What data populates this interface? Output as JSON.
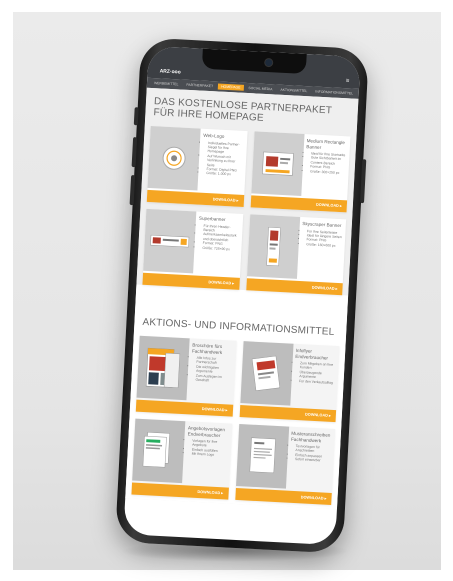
{
  "site": {
    "brand": "ARZ·ooo",
    "tabs": [
      "WERBEMITTEL",
      "PARTNERPAKET",
      "HOMEPAGE",
      "SOCIAL MEDIA",
      "AKTIONSMITTEL",
      "INFORMATIONSMITTEL"
    ],
    "active_tab_index": 2
  },
  "section1": {
    "title": "DAS KOSTENLOSE PARTNERPAKET FÜR IHRE HOMEPAGE",
    "cards": [
      {
        "title": "Web-Logo",
        "bullets": [
          "Individuelles Partner-Siegel für Ihre Homepage",
          "Auf Wunsch mit Verlinkung zu Ihrer Seite",
          "Format: Digital PNG",
          "Größe: 1.000 px"
        ],
        "download": "DOWNLOAD ▸"
      },
      {
        "title": "Medium Rectangle Banner",
        "bullets": [
          "Ideal für Ihre Startseite",
          "Gute Sichtbarkeit im Content-Bereich",
          "Format: PNG",
          "Größe: 300×250 px"
        ],
        "download": "DOWNLOAD ▸"
      },
      {
        "title": "Superbanner",
        "bullets": [
          "Für Ihren Header-Bereich",
          "Aufmerksamkeitsstark und übersichtlich",
          "Format: PNG",
          "Größe: 728×90 px"
        ],
        "download": "DOWNLOAD ▸"
      },
      {
        "title": "Skyscraper Banner",
        "bullets": [
          "Für Ihre Seitenleiste",
          "Ideal für längere Seiten",
          "Format: PNG",
          "Größe: 160×600 px"
        ],
        "download": "DOWNLOAD ▸"
      }
    ]
  },
  "section2": {
    "title": "AKTIONS- UND INFORMATIONSMITTEL",
    "cards": [
      {
        "title": "Broschüre fürs Fachhandwerk",
        "bullets": [
          "Alle Infos zur Partnerschaft",
          "Die wichtigsten Argumente",
          "Zum Auslegen im Geschäft"
        ],
        "download": "DOWNLOAD ▸"
      },
      {
        "title": "Infoflyer Endverbraucher",
        "bullets": [
          "Zum Mitgeben an Ihre Kunden",
          "Überzeugende Argumente",
          "Für den Verkaufsalltag"
        ],
        "download": "DOWNLOAD ▸"
      },
      {
        "title": "Angebotsvorlagen Endverbraucher",
        "bullets": [
          "Vorlagen für Ihre Angebote",
          "Einfach ausfüllen",
          "Mit Ihrem Logo"
        ],
        "download": "DOWNLOAD ▸"
      },
      {
        "title": "Musteranschreiben Fachhandwerk",
        "bullets": [
          "Textvorlagen für Anschreiben",
          "Einfach anpassen",
          "Sofort einsetzbar"
        ],
        "download": "DOWNLOAD ▸"
      }
    ]
  }
}
